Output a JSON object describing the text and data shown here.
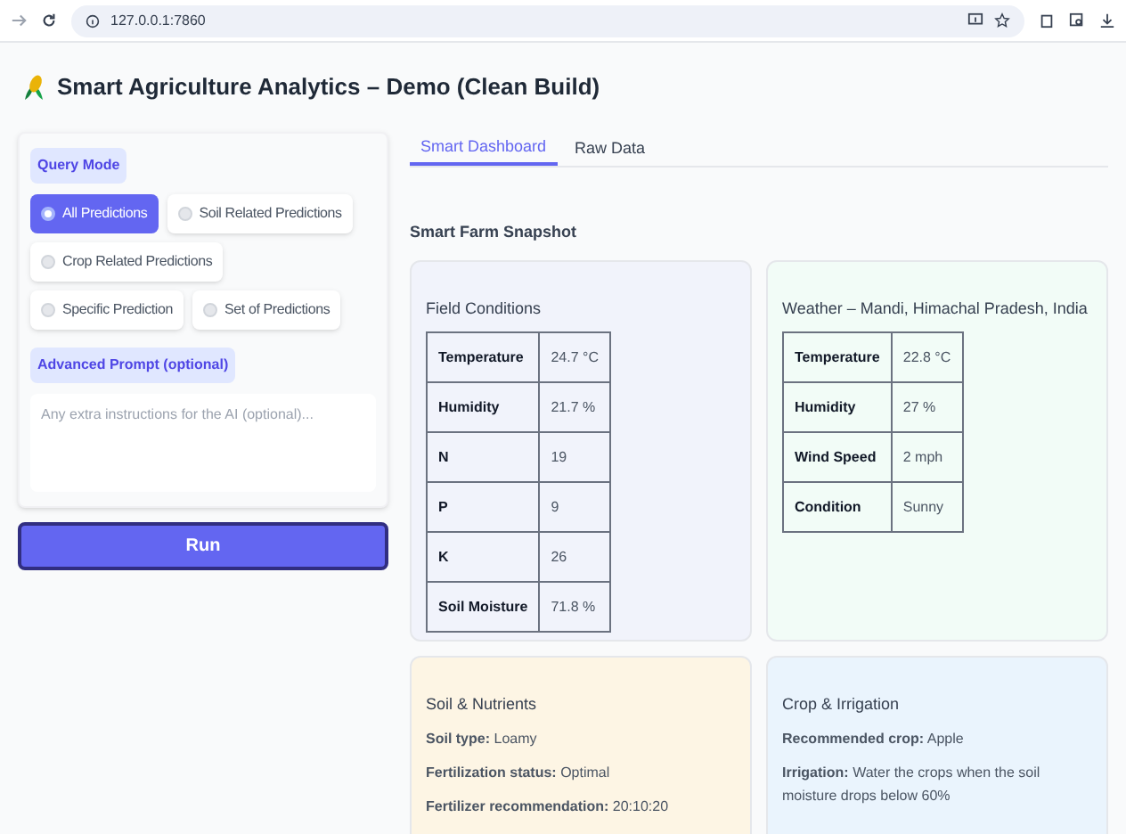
{
  "browser": {
    "url": "127.0.0.1:7860"
  },
  "title": "Smart Agriculture Analytics – Demo (Clean Build)",
  "query_mode": {
    "label": "Query Mode",
    "options": [
      {
        "label": "All Predictions",
        "selected": true
      },
      {
        "label": "Soil Related Predictions",
        "selected": false
      },
      {
        "label": "Crop Related Predictions",
        "selected": false
      },
      {
        "label": "Specific Prediction",
        "selected": false
      },
      {
        "label": "Set of Predictions",
        "selected": false
      }
    ]
  },
  "advanced_prompt": {
    "label": "Advanced Prompt (optional)",
    "placeholder": "Any extra instructions for the AI (optional)..."
  },
  "run_button": "Run",
  "tabs": [
    {
      "label": "Smart Dashboard",
      "selected": true
    },
    {
      "label": "Raw Data",
      "selected": false
    }
  ],
  "section_title": "Smart Farm Snapshot",
  "cards": [
    {
      "kind": "table",
      "title": "Field Conditions",
      "color": "#f1f3fb",
      "rows": [
        [
          "Temperature",
          "24.7 °C"
        ],
        [
          "Humidity",
          "21.7 %"
        ],
        [
          "N",
          "19"
        ],
        [
          "P",
          "9"
        ],
        [
          "K",
          "26"
        ],
        [
          "Soil Moisture",
          "71.8 %"
        ]
      ]
    },
    {
      "kind": "table",
      "title": "Weather – Mandi, Himachal Pradesh, India",
      "color": "#f2fcf7",
      "rows": [
        [
          "Temperature",
          "22.8 °C"
        ],
        [
          "Humidity",
          "27 %"
        ],
        [
          "Wind Speed",
          "2 mph"
        ],
        [
          "Condition",
          "Sunny"
        ]
      ]
    },
    {
      "kind": "text",
      "title": "Soil & Nutrients",
      "color": "#fdf5e4",
      "lines": [
        "**Soil type:** Loamy",
        "**Fertilization status:** Optimal",
        "**Fertilizer recommendation:** 20:10:20"
      ]
    },
    {
      "kind": "text",
      "title": "Crop & Irrigation",
      "color": "#eaf4fd",
      "lines": [
        "**Recommended crop:** Apple",
        "**Irrigation:** Water the crops when the soil moisture drops below 60%"
      ]
    }
  ]
}
